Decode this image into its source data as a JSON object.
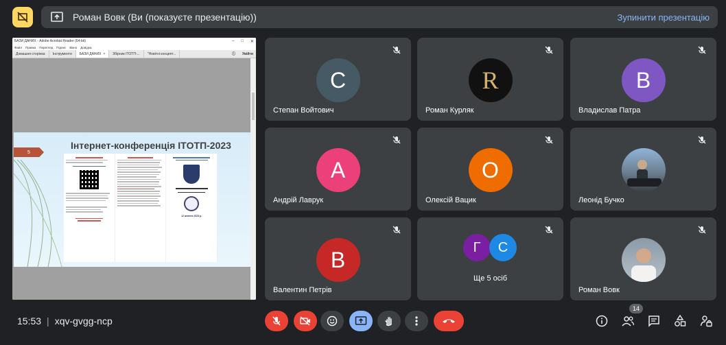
{
  "banner": {
    "title": "Роман Вовк (Ви (показуєте презентацію))",
    "stop_label": "Зупинити презентацію"
  },
  "shared_window": {
    "title": "БАЗИ ДАНИХ - Adobe Acrobat Reader (64-bit)",
    "menu": [
      "Файл",
      "Правка",
      "Перегляд",
      "Підпис",
      "Вікно",
      "Довідка"
    ],
    "tabs": [
      "Домашня сторінка",
      "Інструменти",
      "БАЗИ ДАНИХ",
      "Збірник ITOTП-...",
      "\"Новітні концепт..."
    ],
    "signin": "Увійти",
    "slide_number": "5",
    "slide_title": "Інтернет-конференція ITОТП-2023",
    "brochure_date": "12 жовтня 2023 р."
  },
  "participants": [
    {
      "name": "Степан Войтович",
      "initial": "С",
      "color": "#455a64",
      "muted": true
    },
    {
      "name": "Роман Курляк",
      "initial": "R",
      "color": "#111111",
      "muted": true
    },
    {
      "name": "Владислав Патра",
      "initial": "В",
      "color": "#7e57c2",
      "muted": true
    },
    {
      "name": "Андрій Лаврук",
      "initial": "А",
      "color": "#ec407a",
      "muted": true
    },
    {
      "name": "Олексій Вацик",
      "initial": "О",
      "color": "#ef6c00",
      "muted": true
    },
    {
      "name": "Леонід Бучко",
      "initial": "",
      "color": "#4a6a8a",
      "muted": true
    },
    {
      "name": "Валентин Петрів",
      "initial": "В",
      "color": "#c62828",
      "muted": true
    },
    {
      "name": "Ще 5 осіб",
      "initials": [
        "Г",
        "С"
      ],
      "colors": [
        "#7b1fa2",
        "#1e88e5"
      ],
      "muted": true
    },
    {
      "name": "Роман Вовк",
      "initial": "",
      "color": "#8a9aa8",
      "muted": true
    }
  ],
  "footer": {
    "time": "15:53",
    "meeting_code": "xqv-gvgg-ncp",
    "participant_count": "14"
  },
  "colors": {
    "accent": "#8ab4f8",
    "danger": "#ea4335",
    "present_highlight": "#fdd663"
  }
}
